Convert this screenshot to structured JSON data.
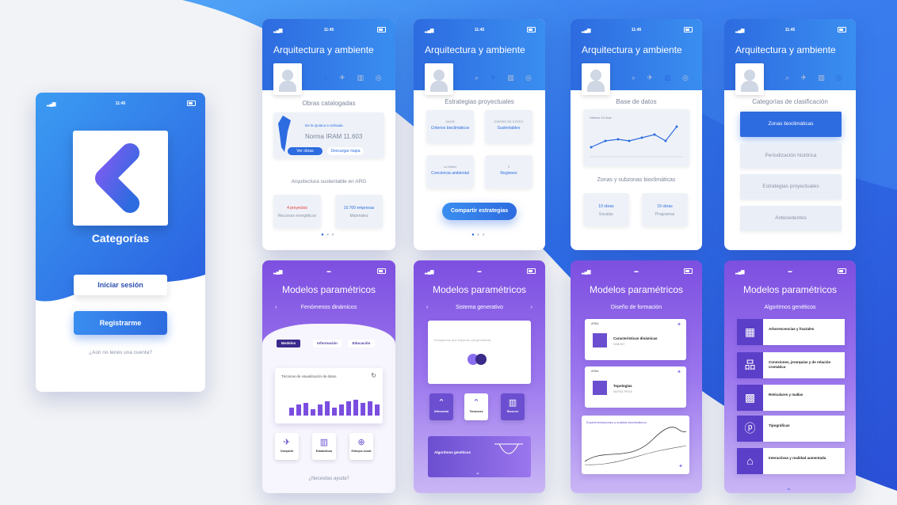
{
  "status": {
    "time": "11:45"
  },
  "app": {
    "title": "Categorías",
    "login_button": "Iniciar sesión",
    "register_button": "Registrarme",
    "no_account_text": "¿Aún no tenés una cuenta?"
  },
  "blue_header_title": "Arquitectura y ambiente",
  "purple_header_title": "Modelos paramétricos",
  "screen1": {
    "section_1": "Obras catalogadas",
    "map_card": {
      "link": "De la Quiaca a Ushuaia",
      "norm": "Norma IRAM 11.603",
      "btn_see": "Ver obras",
      "btn_download": "Descargar mapa"
    },
    "section_2": "Arquitectura sustentable en ARG",
    "card_a": {
      "value": "4 proyectos",
      "label": "Recursos energéticos"
    },
    "card_b": {
      "value": "10.700 empresas",
      "label": "Materiales"
    }
  },
  "screen2": {
    "section": "Estrategias proyectuales",
    "cards": [
      {
        "top": "SAOR",
        "main": "Criterios bioclimáticos"
      },
      {
        "top": "DISEÑO DE ESTEO",
        "main": "Sustentables"
      },
      {
        "top": "La Matriz",
        "main": "Conciencia ambiental"
      },
      {
        "top": "2",
        "main": "Regiones"
      }
    ],
    "share_button": "Compartir estrategias"
  },
  "screen3": {
    "section_1": "Base de datos",
    "chart_label": "Ultimos 15 días",
    "section_2": "Zonas y subzonas bioclimáticas",
    "card_a": {
      "value": "19 obras",
      "label": "Escalas"
    },
    "card_b": {
      "value": "19 obras",
      "label": "Programas"
    }
  },
  "screen4": {
    "section": "Categorías de clasificación",
    "buttons": [
      "Zonas bioclimáticas",
      "Periodización histórica",
      "Estrategias proyectuales",
      "Antecedentes"
    ]
  },
  "screen5": {
    "subtitle": "Fenómenos dinámicos",
    "chips": [
      "Modelos",
      "Información",
      "Educación"
    ],
    "card_title": "Técnicas de visualización de datos",
    "tiles": [
      "Compartir",
      "Estadísticas",
      "Enfoque social"
    ],
    "help": "¿Necesitas ayuda?"
  },
  "screen6": {
    "subtitle": "Sistema generativo",
    "card_text": "Ensayemos que explorar una geometría",
    "tiles": [
      "Diferencial",
      "Tensiones",
      "Recorrer"
    ],
    "bottom": "Algoritmos genéticos"
  },
  "screen7": {
    "subtitle": "Diseño de formación",
    "item_a": {
      "tag": "ARBA",
      "title": "Características dinámicas",
      "sub": "HABITAT"
    },
    "item_b": {
      "tag": "ARBA",
      "title": "Topologías",
      "sub": "MATRIZ PROA"
    },
    "graph_label": "Experimentaciones y análisis bioclimáticos"
  },
  "screen8": {
    "subtitle": "Algoritmos genéticos",
    "items": [
      "Arborescencias y fractales",
      "Conexiones, jerarquías y de relación cromática",
      "Retículares y mallas",
      "Tipográficas",
      "Interactivas y realidad aumentada"
    ]
  }
}
